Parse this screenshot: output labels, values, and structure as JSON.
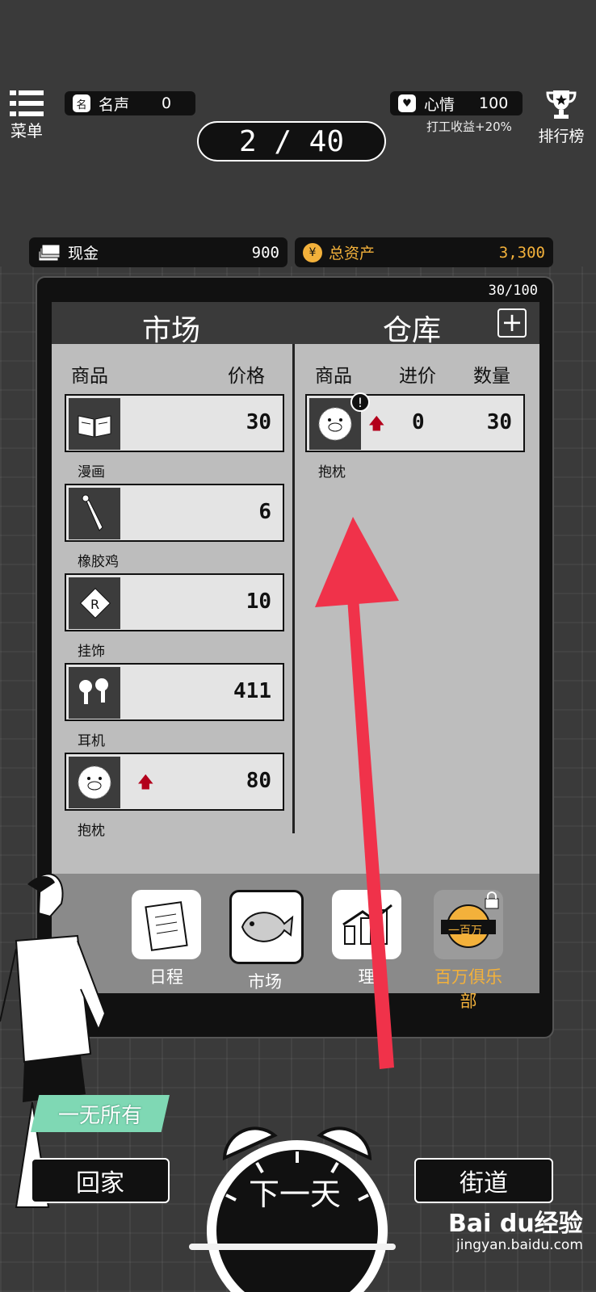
{
  "header": {
    "menu_label": "菜单",
    "fame_label": "名声",
    "fame_value": "0",
    "mood_label": "心情",
    "mood_value": "100",
    "mood_bonus": "打工收益+20%",
    "rank_label": "排行榜",
    "day": "2 / 40"
  },
  "money": {
    "cash_label": "现金",
    "cash_value": "900",
    "assets_label": "总资产",
    "assets_value": "3,300"
  },
  "panel": {
    "capacity": "30/100",
    "market_title": "市场",
    "warehouse_title": "仓库",
    "market_col_item": "商品",
    "market_col_price": "价格",
    "wh_col_item": "商品",
    "wh_col_cost": "进价",
    "wh_col_qty": "数量",
    "market_items": [
      {
        "name": "漫画",
        "price": "30",
        "icon": "book-icon"
      },
      {
        "name": "橡胶鸡",
        "price": "6",
        "icon": "rubber-chicken-icon"
      },
      {
        "name": "挂饰",
        "price": "10",
        "icon": "pendant-icon"
      },
      {
        "name": "耳机",
        "price": "411",
        "icon": "earbuds-icon"
      },
      {
        "name": "抱枕",
        "price": "80",
        "icon": "pillow-icon",
        "trend": "up"
      }
    ],
    "warehouse_items": [
      {
        "name": "抱枕",
        "cost": "0",
        "qty": "30",
        "icon": "pillow-icon",
        "trend": "up"
      }
    ]
  },
  "nav": {
    "schedule": "日程",
    "market": "市场",
    "finance": "理",
    "club": "百万俱乐部",
    "club_badge": "一百万"
  },
  "footer": {
    "status": "一无所有",
    "home": "回家",
    "next_day": "下一天",
    "street": "街道"
  },
  "watermark": {
    "brand": "Bai du经验",
    "url": "jingyan.baidu.com"
  },
  "colors": {
    "accent_gold": "#f3b13b",
    "trend_up": "#b3001b",
    "tag_green": "#7fd8b4",
    "annotation_arrow": "#f0324a"
  }
}
